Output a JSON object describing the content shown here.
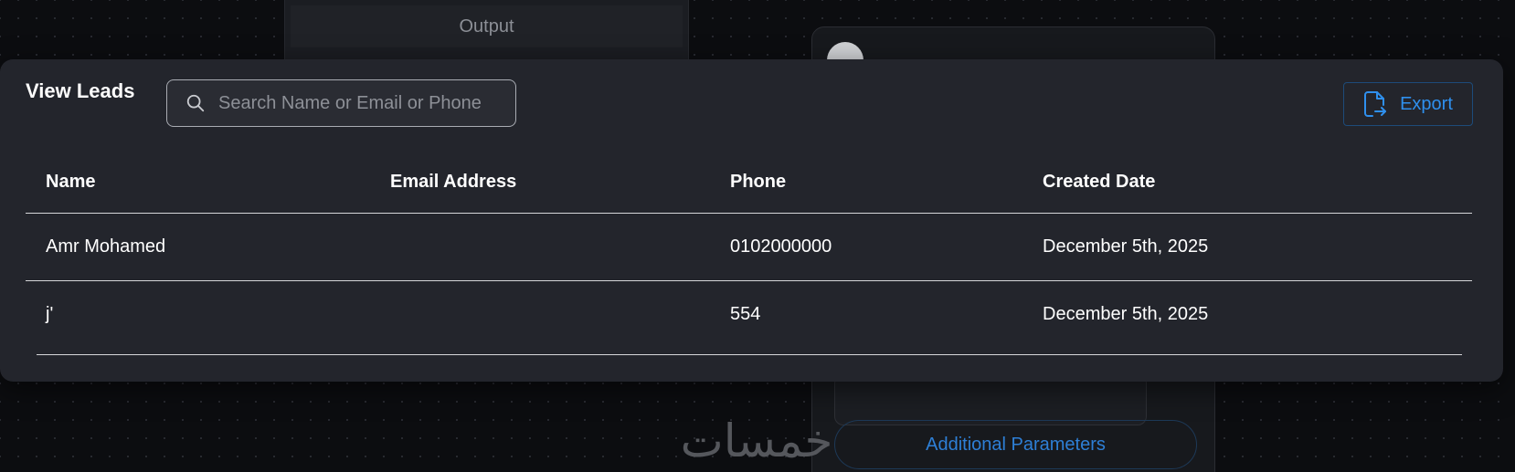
{
  "background": {
    "output_panel_title": "Output",
    "additional_parameters_label": "Additional Parameters",
    "watermark": "خمسات"
  },
  "modal": {
    "title": "View Leads",
    "search": {
      "placeholder": "Search Name or Email or Phone",
      "value": ""
    },
    "export_label": "Export",
    "table": {
      "columns": [
        "Name",
        "Email Address",
        "Phone",
        "Created Date"
      ],
      "rows": [
        {
          "name": "Amr Mohamed",
          "email": "",
          "phone": "0102000000",
          "created": "December 5th, 2025"
        },
        {
          "name": "j'",
          "email": "",
          "phone": "554",
          "created": "December 5th, 2025"
        }
      ]
    }
  },
  "colors": {
    "modal_bg": "#23252c",
    "accent": "#2f90ee",
    "page_bg": "#0c0d10"
  },
  "icons": {
    "search": "search-icon",
    "export": "file-export-icon"
  }
}
